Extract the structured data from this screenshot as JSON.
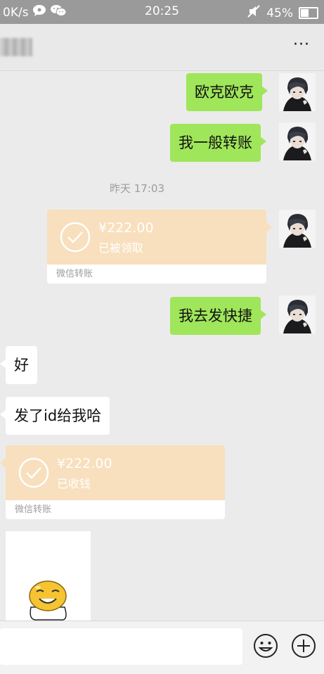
{
  "status_bar": {
    "net_speed": "0K/s",
    "time": "20:25",
    "battery": "45%",
    "battery_level": 0.45
  },
  "messages": {
    "m1": "欧克欧克",
    "m2": "我一般转账",
    "timestamp": "昨天 17:03",
    "transfer1": {
      "amount": "¥222.00",
      "status": "已被领取",
      "label": "微信转账"
    },
    "m3": "我去发快捷",
    "m4": "好",
    "m5": "发了id给我哈",
    "transfer2": {
      "amount": "¥222.00",
      "status": "已收钱",
      "label": "微信转账"
    }
  },
  "icons": [
    "chat-app-icon",
    "wechat-icon",
    "mute-icon",
    "battery-icon",
    "more-icon",
    "check-icon",
    "emoji-icon",
    "plus-icon"
  ],
  "colors": {
    "sent_bubble": "#9fe65a",
    "transfer_bubble": "#f8dfbd",
    "background": "#ebebeb"
  }
}
